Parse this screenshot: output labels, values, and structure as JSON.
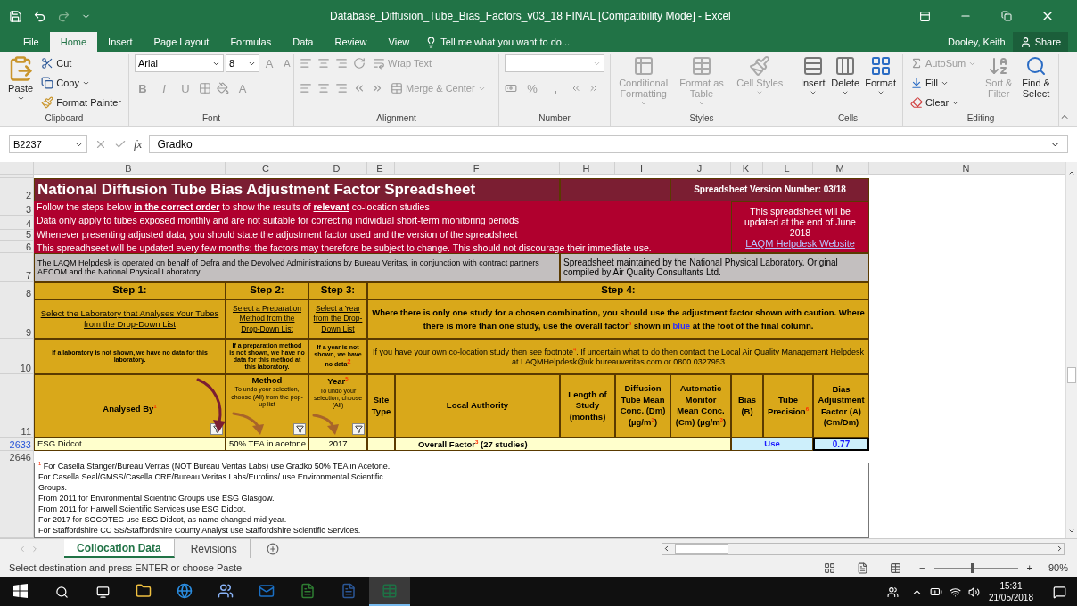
{
  "window": {
    "title": "Database_Diffusion_Tube_Bias_Factors_v03_18 FINAL  [Compatibility Mode] - Excel"
  },
  "ribbon_tabs": [
    {
      "label": "File",
      "selected": false
    },
    {
      "label": "Home",
      "selected": true
    },
    {
      "label": "Insert",
      "selected": false
    },
    {
      "label": "Page Layout",
      "selected": false
    },
    {
      "label": "Formulas",
      "selected": false
    },
    {
      "label": "Data",
      "selected": false
    },
    {
      "label": "Review",
      "selected": false
    },
    {
      "label": "View",
      "selected": false
    }
  ],
  "tell_me": "Tell me what you want to do...",
  "user": "Dooley, Keith",
  "share": "Share",
  "ribbon": {
    "groups": [
      {
        "kind": "clipboard",
        "label": "Clipboard",
        "items": [
          {
            "label": "Paste",
            "disabled": false
          },
          {
            "label": "Cut",
            "disabled": false
          },
          {
            "label": "Copy",
            "disabled": false
          },
          {
            "label": "Format Painter",
            "disabled": false
          }
        ]
      },
      {
        "kind": "font",
        "label": "Font",
        "font": "Arial",
        "size": "8",
        "items": [
          {
            "label": "B",
            "disabled": true
          },
          {
            "label": "I",
            "disabled": true
          },
          {
            "label": "U",
            "disabled": true
          },
          {
            "label": "A",
            "disabled": true
          },
          {
            "label": "A",
            "disabled": true
          },
          {
            "label": "A",
            "disabled": true
          }
        ]
      },
      {
        "kind": "alignment",
        "label": "Alignment",
        "items": [
          {
            "label": "Wrap Text",
            "disabled": true
          },
          {
            "label": "Merge & Center",
            "disabled": true
          }
        ]
      },
      {
        "kind": "number",
        "label": "Number",
        "items": [
          {
            "label": "%",
            "disabled": true
          },
          {
            "label": ",",
            "disabled": true
          }
        ]
      },
      {
        "kind": "large",
        "label": "Styles",
        "items": [
          {
            "label": "Conditional Formatting",
            "disabled": true
          },
          {
            "label": "Format as Table",
            "disabled": true
          },
          {
            "label": "Cell Styles",
            "disabled": true
          }
        ]
      },
      {
        "kind": "large",
        "label": "Cells",
        "items": [
          {
            "label": "Insert",
            "disabled": false
          },
          {
            "label": "Delete",
            "disabled": false
          },
          {
            "label": "Format",
            "disabled": false
          }
        ]
      },
      {
        "kind": "editing",
        "label": "Editing",
        "items": [
          {
            "label": "AutoSum",
            "disabled": true
          },
          {
            "label": "Fill",
            "disabled": false
          },
          {
            "label": "Clear",
            "disabled": false
          },
          {
            "label": "Sort & Filter",
            "disabled": true
          },
          {
            "label": "Find & Select",
            "disabled": false
          }
        ]
      }
    ]
  },
  "formula_bar": {
    "name_box": "B2237",
    "fx": "fx",
    "value": "Gradko"
  },
  "sheet": {
    "columns": [
      "B",
      "C",
      "D",
      "E",
      "F",
      "H",
      "I",
      "J",
      "K",
      "L",
      "M",
      "N"
    ],
    "rows": [
      {
        "label": "2",
        "filtered": false
      },
      {
        "label": "3",
        "filtered": false
      },
      {
        "label": "4",
        "filtered": false
      },
      {
        "label": "5",
        "filtered": false
      },
      {
        "label": "6",
        "filtered": false
      },
      {
        "label": "7",
        "filtered": false
      },
      {
        "label": "8",
        "filtered": false
      },
      {
        "label": "9",
        "filtered": false
      },
      {
        "label": "10",
        "filtered": false
      },
      {
        "label": "11",
        "filtered": false
      },
      {
        "label": "2633",
        "filtered": true
      },
      {
        "label": "2646",
        "filtered": false
      }
    ],
    "title": "National Diffusion Tube Bias Adjustment Factor Spreadsheet",
    "version": "Spreadsheet Version Number: 03/18",
    "notes": [
      "Follow the steps below **in the correct order** to show the results of **relevant** co-location studies",
      "Data only apply to tubes exposed monthly and are not suitable for correcting individual short-term monitoring periods",
      "Whenever presenting adjusted data, you should state the adjustment factor used and the version of the spreadsheet",
      "This spreadhseet will be updated every few months: the factors may therefore be subject to change. This should not discourage their immediate use."
    ],
    "update_notice": "This spreadsheet will be updated at the end of June 2018",
    "helpdesk_link": "LAQM Helpdesk Website",
    "operator_note": "The LAQM Helpdesk is operated on behalf of Defra and the Devolved Administrations by Bureau Veritas, in conjunction with contract partners AECOM and the National Physical Laboratory.",
    "maintainer_note": "Spreadsheet maintained by the National Physical Laboratory. Original compiled by Air Quality Consultants Ltd.",
    "steps": [
      {
        "title": "Step 1:",
        "instruction": "Select the Laboratory that Analyses Your Tubes from the Drop-Down List",
        "note": "If a laboratory is not shown,  we have no data for this laboratory."
      },
      {
        "title": "Step 2:",
        "instruction": "Select a Preparation Method from the Drop-Down List",
        "note": "If a preparation method is not shown, we have no data for this method at this laboratory."
      },
      {
        "title": "Step 3:",
        "instruction": "Select a Year from the Drop-Down List",
        "note": "If a year is not shown, we have no data$^{2}$"
      }
    ],
    "step4": {
      "title": "Step 4:",
      "instruction": "Where there is only one study for a chosen combination, you should use the adjustment factor shown with caution.  Where there is more than one study, use the overall factor$^{3}$ shown in",
      "highlight": "blue",
      "instruction_end": "at the foot of the final column.",
      "note": "If you have your own co-location study then see footnote$^{4}$.  If uncertain what to do then contact the Local Air Quality Management Helpdesk at LAQMHelpdesk@uk.bureauveritas.com or 0800 0327953"
    },
    "headers": [
      {
        "label": "Analysed By$^{1}$",
        "filter": true
      },
      {
        "label": "Method",
        "hint": "To undo your selection, choose (All) from the pop-up list",
        "filter": true
      },
      {
        "label": "Year$^{5}$",
        "hint": "To undo your selection, choose (All)",
        "filter": true
      },
      {
        "label": "Site Type",
        "filter": false
      },
      {
        "label": "Local Authority",
        "filter": false
      },
      {
        "label": "Length of Study (months)",
        "filter": false
      },
      {
        "label": "Diffusion Tube Mean Conc. (Dm) (µg/m$^{3}$)",
        "filter": false
      },
      {
        "label": "Automatic Monitor Mean Conc. (Cm) (µg/m$^{3}$)",
        "filter": false
      },
      {
        "label": "Bias (B)",
        "filter": false
      },
      {
        "label": "Tube Precision$^{6}$",
        "filter": false
      },
      {
        "label": "Bias Adjustment Factor (A) (Cm/Dm)",
        "filter": false
      }
    ],
    "result": {
      "analysed_by": "ESG Didcot",
      "method": "50% TEA in acetone",
      "year": "2017",
      "overall": "Overall Factor$^{3}$ (27 studies)",
      "precision": "Use",
      "factor": "0.77"
    },
    "footnotes": [
      "$^{1}$ For Casella Stanger/Bureau Veritas (NOT Bureau Veritas Labs) use Gradko 50% TEA in Acetone.",
      "For Casella Seal/GMSS/Casella CRE/Bureau Veritas Labs/Eurofins/ use Environmental Scientific",
      "Groups.",
      "From 2011 for Environmental Scientific Groups use ESG Glasgow.",
      "From 2011 for Harwell Scientific Services use ESG Didcot.",
      "For 2017 for SOCOTEC use ESG Didcot, as name changed mid year.",
      "For Staffordshire CC SS/Staffordshire County Analyst use Staffordshire Scientific Services."
    ]
  },
  "sheet_tabs": [
    {
      "label": "Collocation Data",
      "selected": true
    },
    {
      "label": "Revisions",
      "selected": false
    }
  ],
  "status": {
    "message": "Select destination and press ENTER or choose Paste",
    "minus": "−",
    "plus": "+",
    "zoom": "90%",
    "level": 0.45
  },
  "taskbar": {
    "apps": [
      {
        "active": false
      },
      {
        "active": false
      },
      {
        "active": false
      },
      {
        "active": false
      },
      {
        "active": false
      },
      {
        "active": false
      },
      {
        "active": true
      }
    ],
    "time": "15:31",
    "date": "21/05/2018"
  }
}
